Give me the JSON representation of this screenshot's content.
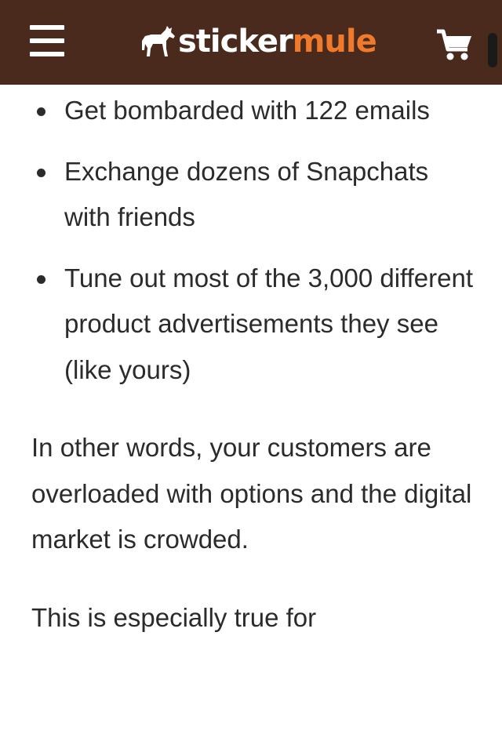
{
  "header": {
    "logo_part1": "sticker",
    "logo_part2": "mule",
    "colors": {
      "background": "#4a2a1c",
      "logo_white": "#ffffff",
      "logo_orange": "#ef7a2b"
    },
    "icons": {
      "menu": "hamburger-menu-icon",
      "logo": "mule-logo-icon",
      "cart": "shopping-cart-icon"
    }
  },
  "article": {
    "bullets": [
      "Get bombarded with 122 emails",
      "Exchange dozens of Snapchats with friends",
      "Tune out most of the 3,000 different product advertisements they see (like yours)"
    ],
    "paragraph1": "In other words, your customers are overloaded with options and the digital market is crowded.",
    "paragraph2": "This is especially true for"
  }
}
